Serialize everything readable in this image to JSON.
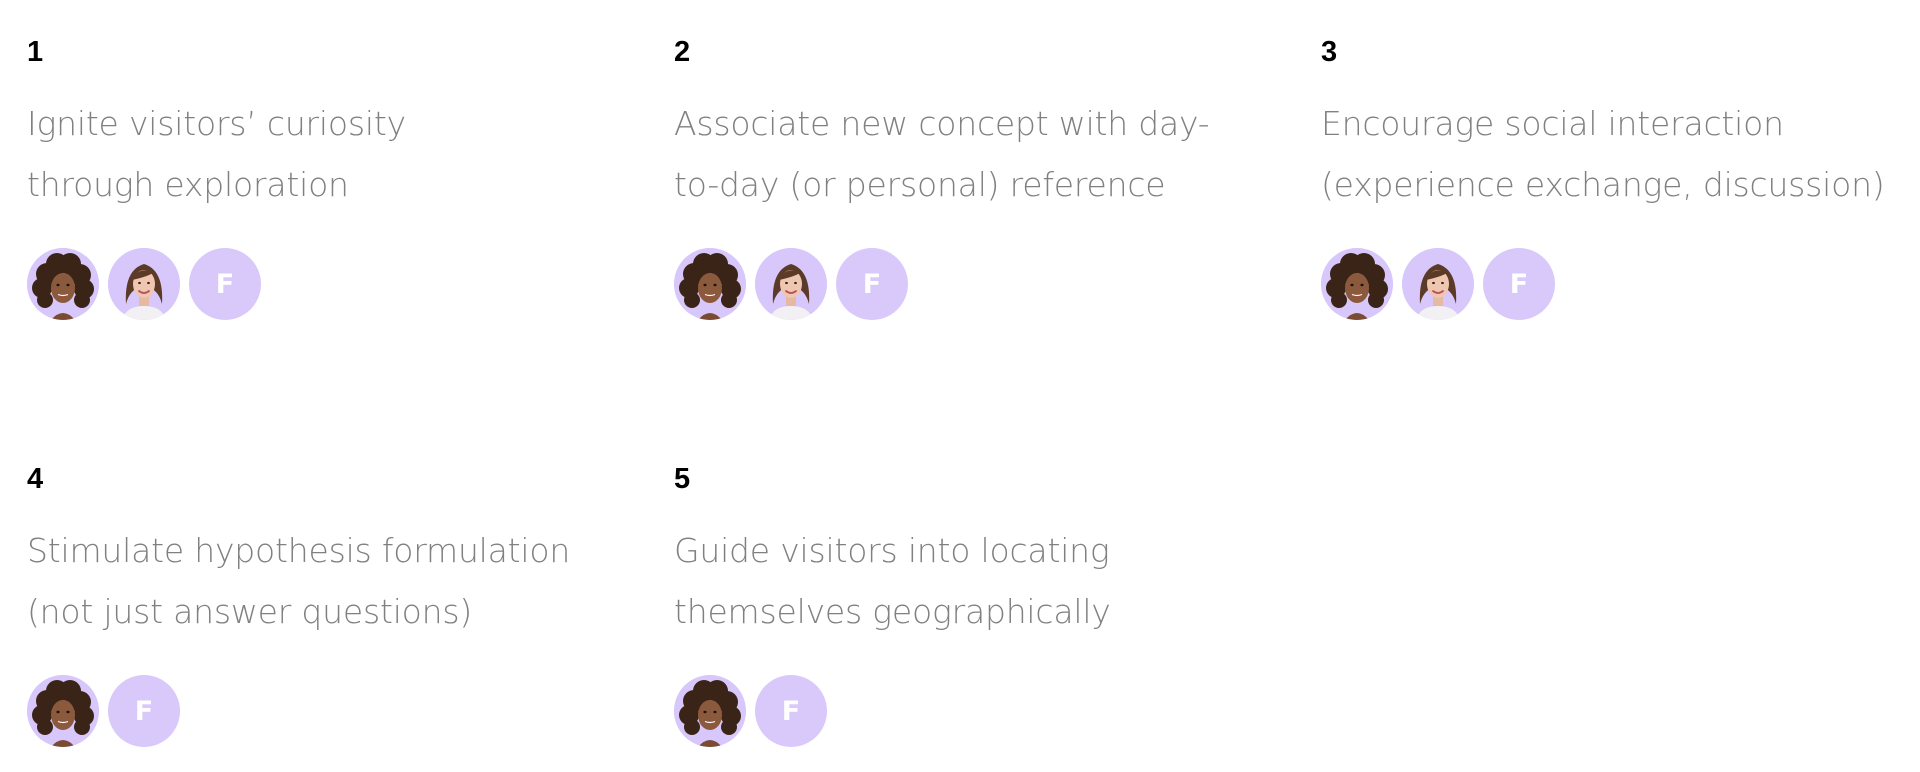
{
  "goals": [
    {
      "number": "1",
      "title_lines": [
        "Ignite visitors’ curiosity",
        "through exploration"
      ],
      "avatars": [
        "woman-curly-hair",
        "woman-brown-hair",
        "F"
      ]
    },
    {
      "number": "2",
      "title_lines": [
        "Associate new concept with day-",
        "to-day (or personal) reference"
      ],
      "avatars": [
        "woman-curly-hair",
        "woman-brown-hair",
        "F"
      ]
    },
    {
      "number": "3",
      "title_lines": [
        "Encourage social interaction",
        "(experience exchange, discussion)"
      ],
      "avatars": [
        "woman-curly-hair",
        "woman-brown-hair",
        "F"
      ]
    },
    {
      "number": "4",
      "title_lines": [
        "Stimulate hypothesis formulation",
        "(not just answer questions)"
      ],
      "avatars": [
        "woman-curly-hair",
        "F"
      ]
    },
    {
      "number": "5",
      "title_lines": [
        "Guide visitors into locating",
        "themselves geographically"
      ],
      "avatars": [
        "woman-curly-hair",
        "F"
      ]
    }
  ],
  "colors": {
    "avatar_bg": "#d8c7fb",
    "title_text": "#808080",
    "number_text": "#000000"
  }
}
